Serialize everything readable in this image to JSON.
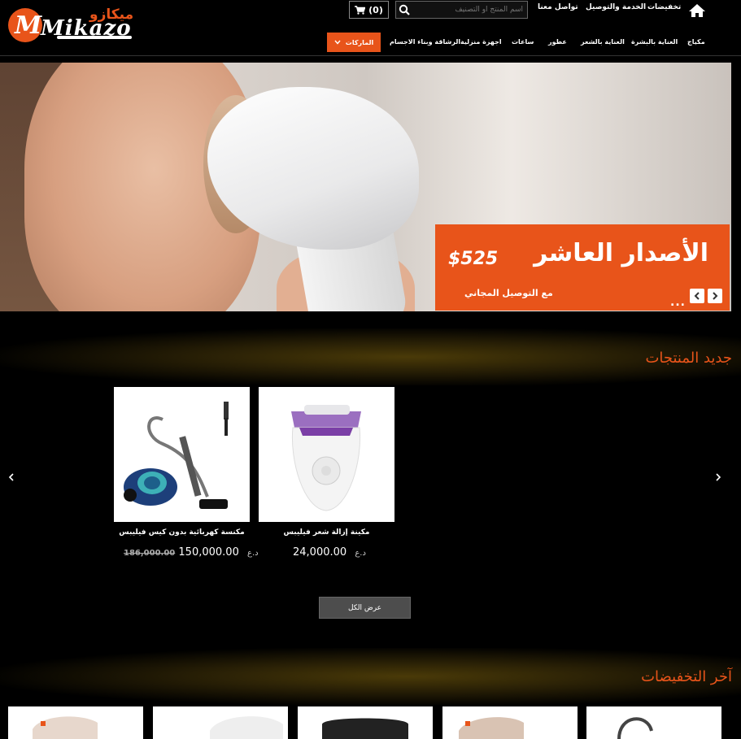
{
  "header": {
    "logo_latin": "Mikazo",
    "logo_arabic": "ميكازو",
    "top_links": {
      "discounts": "تخفيضات",
      "delivery": "الخدمة والتوصيل",
      "contact": "تواصل معنا"
    },
    "search_placeholder": "اسم المنتج أو التصنيف",
    "cart_count": "(0)"
  },
  "nav": {
    "items": [
      "مكياج",
      "العناية بالبشرة",
      "العناية بالشعر",
      "عطور",
      "ساعات",
      "اجهزة منزلية",
      "الرشاقة وبناء الاجسام"
    ],
    "brands_label": "الماركات"
  },
  "banner": {
    "headline": "الأصدار العاشر",
    "price": "$525",
    "subline": "مع التوصيل المجاني",
    "dots": "..."
  },
  "new_products": {
    "title": "جديد المنتجات",
    "products": [
      {
        "name": "مكنسة كهربائية بدون كيس فيليبس",
        "price": "150,000.00",
        "old_price": "186,000.00",
        "currency": "د.ع"
      },
      {
        "name": "مكينة إزالة شعر فيليبس",
        "price": "24,000.00",
        "currency": "د.ع"
      }
    ],
    "view_all": "عرض الكل"
  },
  "discounts_section": {
    "title": "آخر التخفيضات"
  },
  "colors": {
    "accent": "#e8541a",
    "background": "#000000"
  }
}
